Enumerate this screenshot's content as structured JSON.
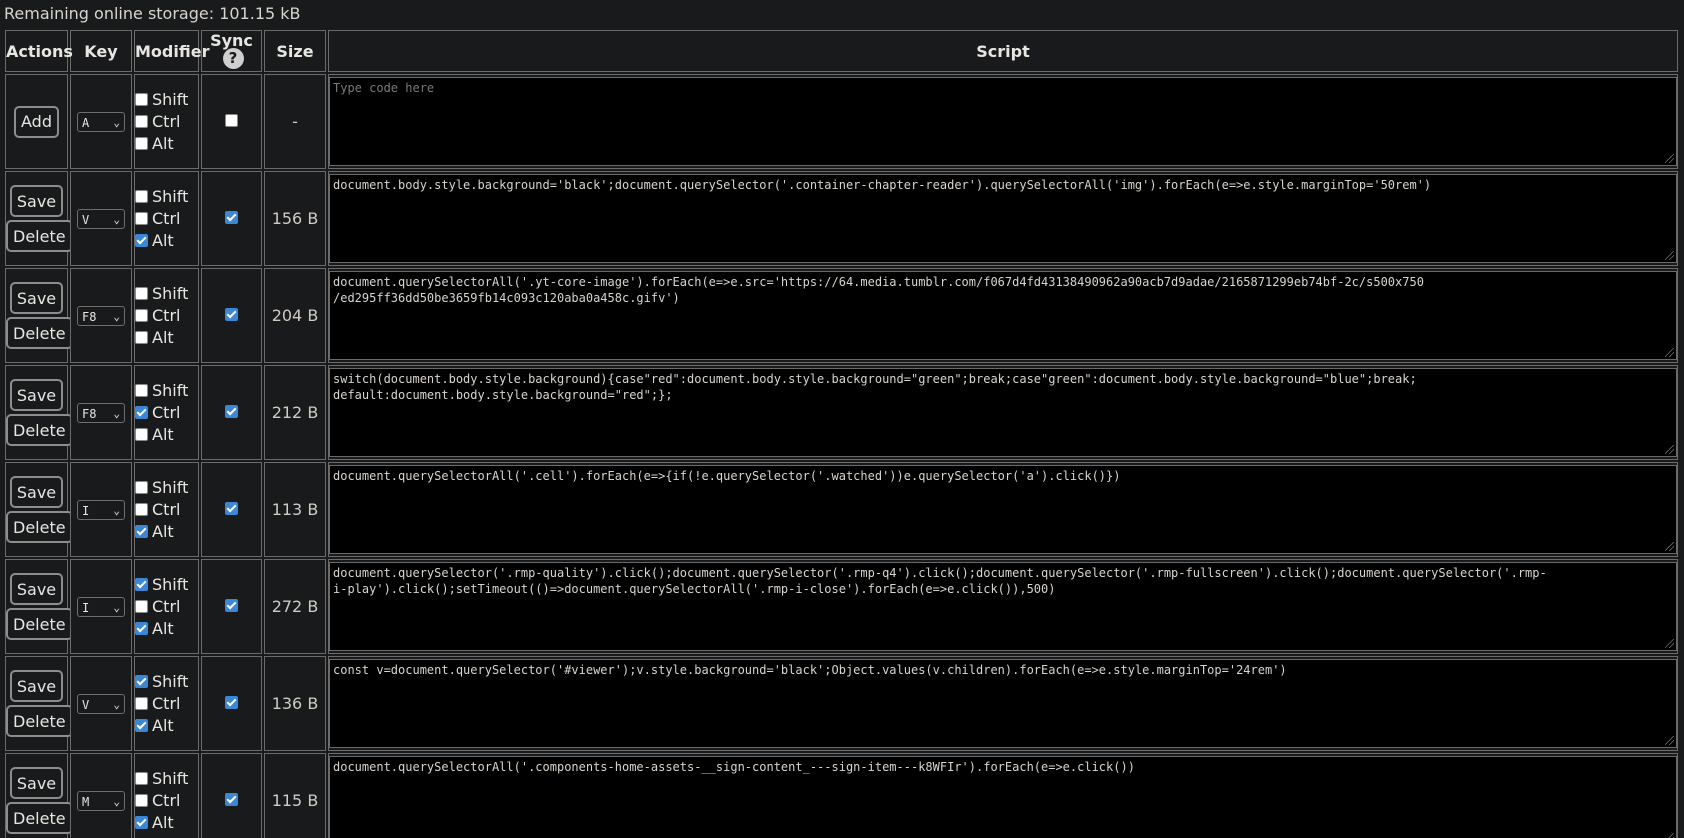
{
  "storage": {
    "label": "Remaining online storage: 101.15 kB"
  },
  "headers": {
    "actions": "Actions",
    "key": "Key",
    "modifier": "Modifier",
    "sync": "Sync",
    "sync_help": "?",
    "size": "Size",
    "script": "Script"
  },
  "modifier_labels": {
    "shift": "Shift",
    "ctrl": "Ctrl",
    "alt": "Alt"
  },
  "new_row": {
    "add_label": "Add",
    "key": "A",
    "shift": false,
    "ctrl": false,
    "alt": false,
    "sync": false,
    "size": "-",
    "placeholder": "Type code here"
  },
  "rows": [
    {
      "save_label": "Save",
      "delete_label": "Delete",
      "key": "V",
      "shift": false,
      "ctrl": false,
      "alt": true,
      "sync": true,
      "size": "156 B",
      "script": "document.body.style.background='black';document.querySelector('.container-chapter-reader').querySelectorAll('img').forEach(e=>e.style.marginTop='50rem')"
    },
    {
      "save_label": "Save",
      "delete_label": "Delete",
      "key": "F8",
      "shift": false,
      "ctrl": false,
      "alt": false,
      "sync": true,
      "size": "204 B",
      "script": "document.querySelectorAll('.yt-core-image').forEach(e=>e.src='https://64.media.tumblr.com/f067d4fd43138490962a90acb7d9adae/2165871299eb74bf-2c/s500x750\n/ed295ff36dd50be3659fb14c093c120aba0a458c.gifv')"
    },
    {
      "save_label": "Save",
      "delete_label": "Delete",
      "key": "F8",
      "shift": false,
      "ctrl": true,
      "alt": false,
      "sync": true,
      "size": "212 B",
      "script": "switch(document.body.style.background){case\"red\":document.body.style.background=\"green\";break;case\"green\":document.body.style.background=\"blue\";break;\ndefault:document.body.style.background=\"red\";};"
    },
    {
      "save_label": "Save",
      "delete_label": "Delete",
      "key": "I",
      "shift": false,
      "ctrl": false,
      "alt": true,
      "sync": true,
      "size": "113 B",
      "script": "document.querySelectorAll('.cell').forEach(e=>{if(!e.querySelector('.watched'))e.querySelector('a').click()})"
    },
    {
      "save_label": "Save",
      "delete_label": "Delete",
      "key": "I",
      "shift": true,
      "ctrl": false,
      "alt": true,
      "sync": true,
      "size": "272 B",
      "script": "document.querySelector('.rmp-quality').click();document.querySelector('.rmp-q4').click();document.querySelector('.rmp-fullscreen').click();document.querySelector('.rmp-\ni-play').click();setTimeout(()=>document.querySelectorAll('.rmp-i-close').forEach(e=>e.click()),500)"
    },
    {
      "save_label": "Save",
      "delete_label": "Delete",
      "key": "V",
      "shift": true,
      "ctrl": false,
      "alt": true,
      "sync": true,
      "size": "136 B",
      "script": "const v=document.querySelector('#viewer');v.style.background='black';Object.values(v.children).forEach(e=>e.style.marginTop='24rem')"
    },
    {
      "save_label": "Save",
      "delete_label": "Delete",
      "key": "M",
      "shift": false,
      "ctrl": false,
      "alt": true,
      "sync": true,
      "size": "115 B",
      "script": "document.querySelectorAll('.components-home-assets-__sign-content_---sign-item---k8WFIr').forEach(e=>e.click())"
    }
  ]
}
